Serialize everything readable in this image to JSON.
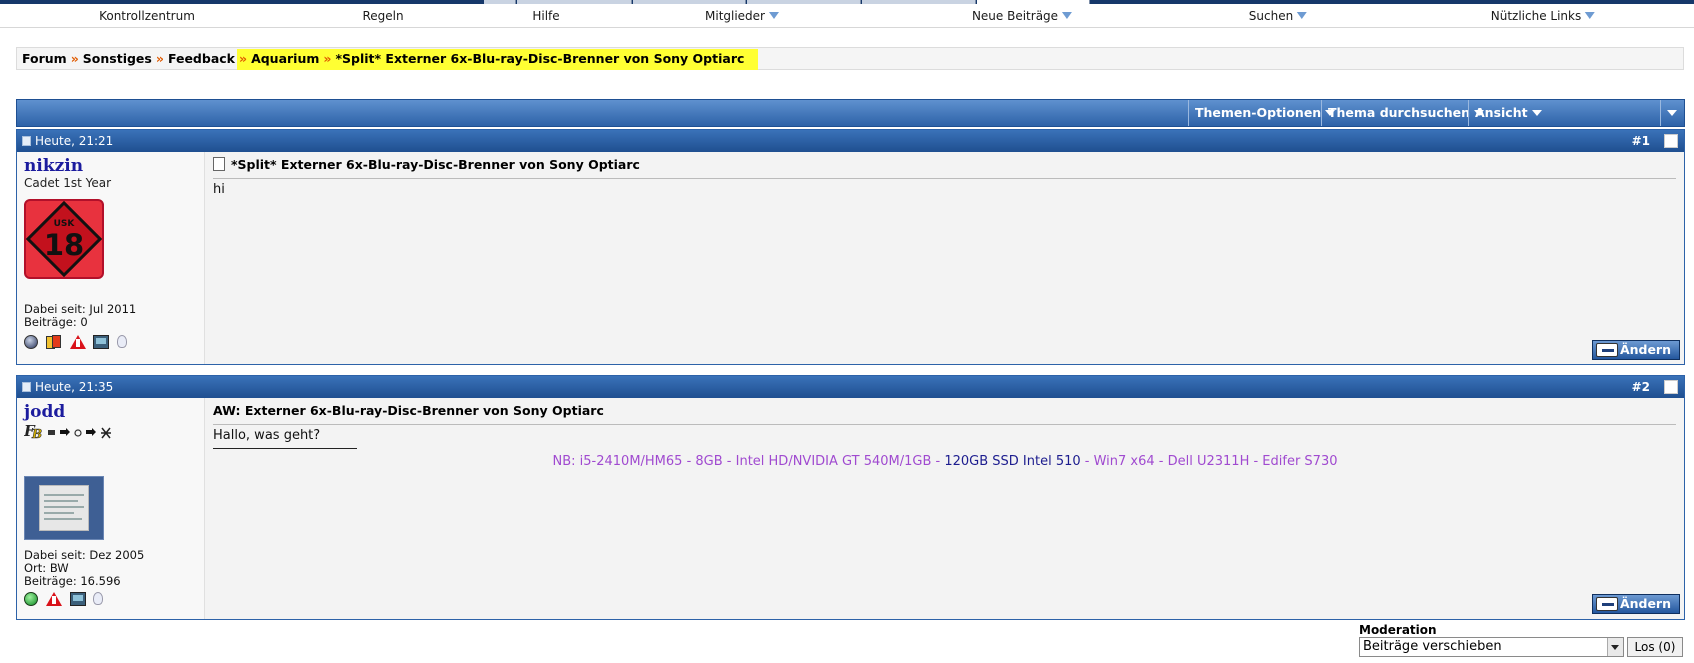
{
  "nav": {
    "items": [
      {
        "label": "Kontrollzentrum",
        "dropdown": false
      },
      {
        "label": "Regeln",
        "dropdown": false
      },
      {
        "label": "Hilfe",
        "dropdown": false
      },
      {
        "label": "Mitglieder",
        "dropdown": true
      },
      {
        "label": "Neue Beiträge",
        "dropdown": true
      },
      {
        "label": "Suchen",
        "dropdown": true
      },
      {
        "label": "Nützliche Links",
        "dropdown": true
      }
    ]
  },
  "breadcrumb": {
    "items": [
      "Forum",
      "Sonstiges",
      "Feedback",
      "Aquarium",
      "*Split* Externer 6x-Blu-ray-Disc-Brenner von Sony Optiarc"
    ],
    "separator": "»"
  },
  "toolbar": {
    "thread_options": "Themen-Optionen",
    "search_thread": "Thema durchsuchen",
    "view": "Ansicht"
  },
  "posts": [
    {
      "date": "Heute, 21:21",
      "number": "#1",
      "username": "nikzin",
      "usertitle": "Cadet 1st Year",
      "avatar_text": {
        "usk": "USK",
        "age": "18"
      },
      "joined": "Dabei seit: Jul 2011",
      "posts_count": "Beiträge: 0",
      "icons": [
        "offline-status-icon",
        "cards-icon",
        "warning-icon",
        "computer-icon",
        "lightbulb-icon"
      ],
      "title": "*Split* Externer 6x-Blu-ray-Disc-Brenner von Sony Optiarc",
      "body": "hi",
      "edit_label": "Ändern"
    },
    {
      "date": "Heute, 21:35",
      "number": "#2",
      "username": "jodd",
      "location": "Ort: BW",
      "joined": "Dabei seit: Dez 2005",
      "posts_count": "Beiträge: 16.596",
      "icons": [
        "online-status-icon",
        "warning-icon",
        "computer-icon",
        "lightbulb-icon"
      ],
      "title": "AW: Externer 6x-Blu-ray-Disc-Brenner von Sony Optiarc",
      "body": "Hallo, was geht?",
      "signature": {
        "part1": "NB: i5-2410M/HM65 - 8GB - Intel HD/NVIDIA GT 540M/1GB - ",
        "part2": "120GB SSD Intel 510",
        "part3": " - Win7 x64 - Dell U2311H - Edifer S730"
      },
      "edit_label": "Ändern"
    }
  ],
  "moderation": {
    "label": "Moderation",
    "selected": "Beiträge verschieben",
    "go_label": "Los (0)"
  },
  "colors": {
    "header_blue": "#2d62a8",
    "username_blue": "#1c1c9e",
    "breadcrumb_highlight": "#ffff33",
    "signature_purple": "#a04ad0"
  }
}
